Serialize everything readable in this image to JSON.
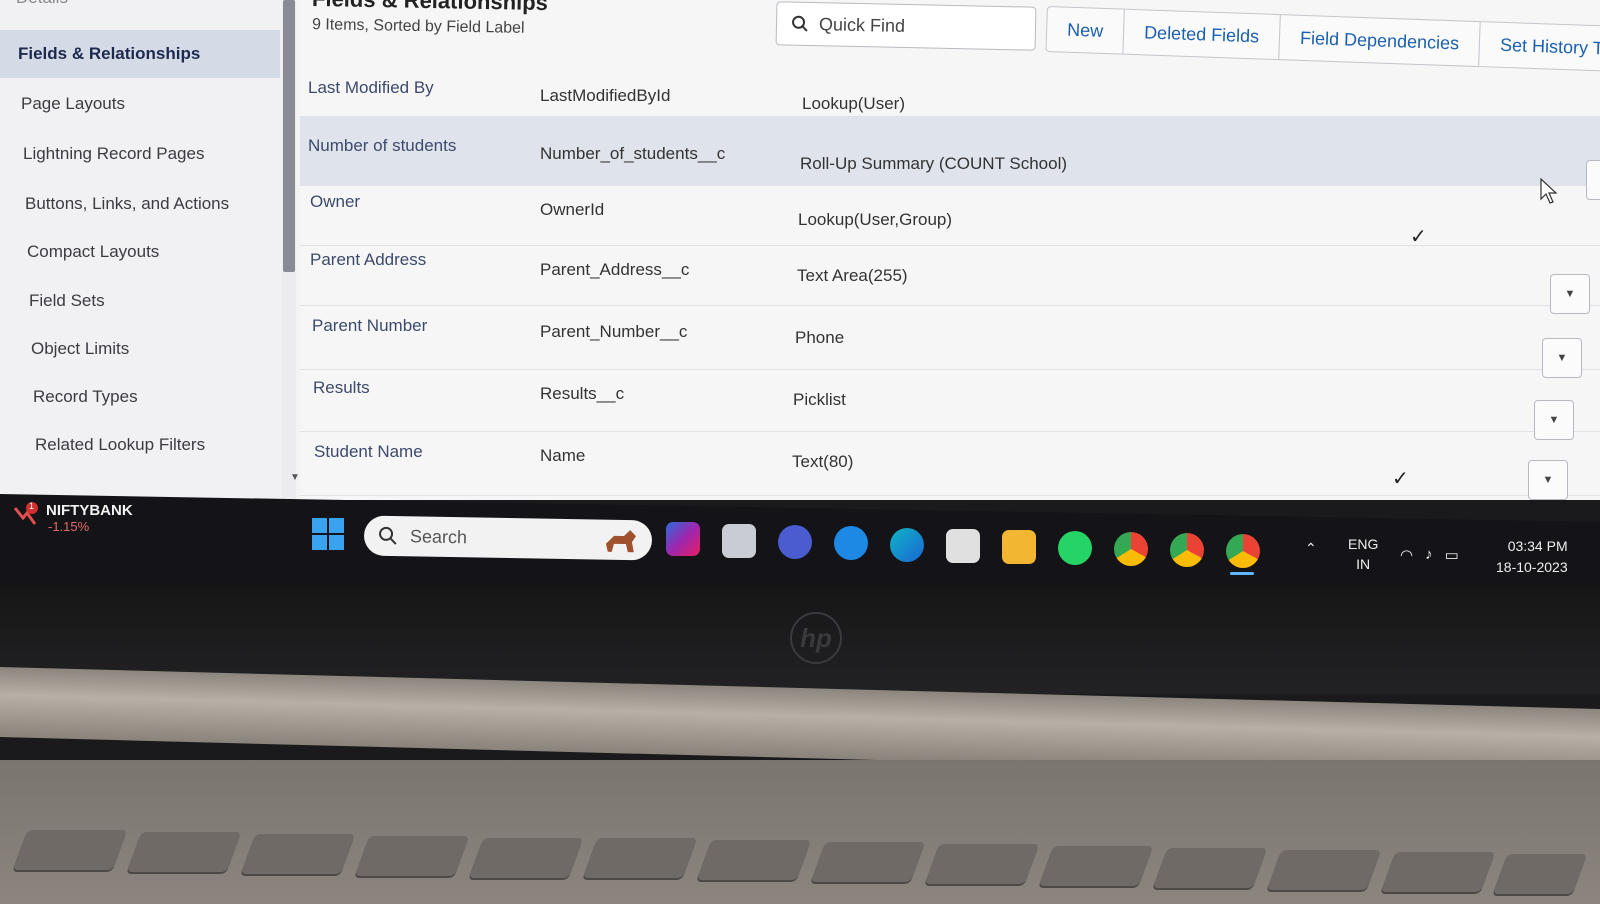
{
  "page": {
    "title": "Fields & Relationships",
    "subtitle": "9 Items, Sorted by Field Label"
  },
  "sidebar": {
    "items": [
      {
        "label": "Details",
        "active": false
      },
      {
        "label": "Fields & Relationships",
        "active": true
      },
      {
        "label": "Page Layouts",
        "active": false
      },
      {
        "label": "Lightning Record Pages",
        "active": false
      },
      {
        "label": "Buttons, Links, and Actions",
        "active": false
      },
      {
        "label": "Compact Layouts",
        "active": false
      },
      {
        "label": "Field Sets",
        "active": false
      },
      {
        "label": "Object Limits",
        "active": false
      },
      {
        "label": "Record Types",
        "active": false
      },
      {
        "label": "Related Lookup Filters",
        "active": false
      }
    ]
  },
  "search": {
    "placeholder": "Quick Find"
  },
  "toolbar": {
    "new_label": "New",
    "deleted_fields_label": "Deleted Fields",
    "field_dependencies_label": "Field Dependencies",
    "set_history_label": "Set History Tra"
  },
  "fields": [
    {
      "label": "Last Modified By",
      "api_name": "LastModifiedById",
      "type": "Lookup(User)",
      "indexed": false
    },
    {
      "label": "Number of students",
      "api_name": "Number_of_students__c",
      "type": "Roll-Up Summary (COUNT School)",
      "indexed": false
    },
    {
      "label": "Owner",
      "api_name": "OwnerId",
      "type": "Lookup(User,Group)",
      "indexed": true
    },
    {
      "label": "Parent Address",
      "api_name": "Parent_Address__c",
      "type": "Text Area(255)",
      "indexed": false
    },
    {
      "label": "Parent Number",
      "api_name": "Parent_Number__c",
      "type": "Phone",
      "indexed": false
    },
    {
      "label": "Results",
      "api_name": "Results__c",
      "type": "Picklist",
      "indexed": false
    },
    {
      "label": "Student Name",
      "api_name": "Name",
      "type": "Text(80)",
      "indexed": true
    }
  ],
  "taskbar": {
    "stock_name": "NIFTYBANK",
    "stock_change": "-1.15%",
    "stock_badge": "1",
    "search_placeholder": "Search",
    "lang_primary": "ENG",
    "lang_secondary": "IN",
    "time": "03:34 PM",
    "date": "18-10-2023",
    "apps": [
      "photoshop-premiere-icon",
      "file-viewer-icon",
      "teams-chat-icon",
      "browser-update-icon",
      "edge-icon",
      "store-icon",
      "file-explorer-icon",
      "whatsapp-icon",
      "chrome-icon",
      "chrome-profile-icon",
      "chrome-active-icon"
    ]
  },
  "laptop": {
    "brand": "hp"
  },
  "colors": {
    "accent_link": "#1b5fb0",
    "active_nav_bg": "#d4dbe6",
    "highlight_row_bg": "#dfe3ec",
    "stock_down": "#e06a6a"
  }
}
